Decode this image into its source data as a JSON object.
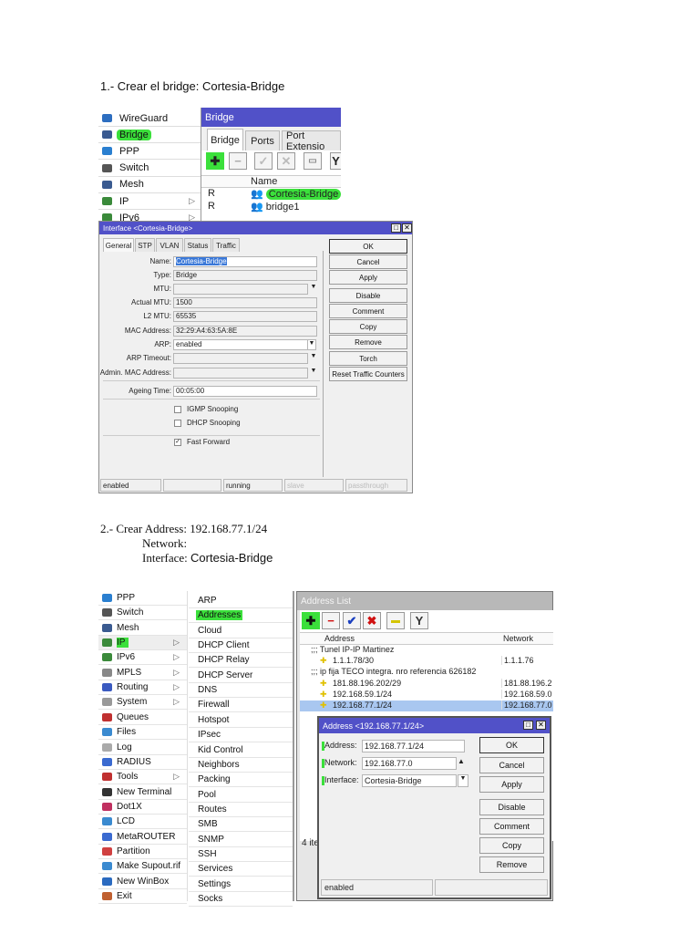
{
  "step1": {
    "heading": "1.- Crear el bridge: Cortesia-Bridge"
  },
  "shot1": {
    "sidebar": [
      "WireGuard",
      "Bridge",
      "PPP",
      "Switch",
      "Mesh",
      "IP",
      "IPv6"
    ],
    "bridge_window": {
      "title": "Bridge",
      "tabs": [
        "Bridge",
        "Ports",
        "Port Extensio"
      ],
      "col_name": "Name",
      "rows": [
        {
          "flag": "R",
          "name": "Cortesia-Bridge"
        },
        {
          "flag": "R",
          "name": "bridge1"
        }
      ]
    },
    "dialog": {
      "title": "Interface <Cortesia-Bridge>",
      "tabs": [
        "General",
        "STP",
        "VLAN",
        "Status",
        "Traffic"
      ],
      "fields": [
        {
          "label": "Name:",
          "value": "Cortesia-Bridge"
        },
        {
          "label": "Type:",
          "value": "Bridge"
        },
        {
          "label": "MTU:",
          "value": ""
        },
        {
          "label": "Actual MTU:",
          "value": "1500"
        },
        {
          "label": "L2 MTU:",
          "value": "65535"
        },
        {
          "label": "MAC Address:",
          "value": "32:29:A4:63:5A:8E"
        },
        {
          "label": "ARP:",
          "value": "enabled"
        },
        {
          "label": "ARP Timeout:",
          "value": ""
        },
        {
          "label": "Admin. MAC Address:",
          "value": ""
        },
        {
          "label": "Ageing Time:",
          "value": "00:05:00"
        }
      ],
      "checkboxes": [
        {
          "label": "IGMP Snooping",
          "checked": false
        },
        {
          "label": "DHCP Snooping",
          "checked": false
        },
        {
          "label": "Fast Forward",
          "checked": true
        }
      ],
      "buttons": [
        "OK",
        "Cancel",
        "Apply",
        "Disable",
        "Comment",
        "Copy",
        "Remove",
        "Torch",
        "Reset Traffic Counters"
      ],
      "status": [
        "enabled",
        "",
        "running",
        "slave",
        "passthrough"
      ]
    }
  },
  "step2": {
    "heading_prefix": "2.- Crear Address: ",
    "heading_value": "192.168.77.1/24",
    "network_label": "Network:",
    "interface_label": "Interface: ",
    "interface_value": "Cortesia-Bridge"
  },
  "shot2": {
    "menu": [
      "PPP",
      "Switch",
      "Mesh",
      "IP",
      "IPv6",
      "MPLS",
      "Routing",
      "System",
      "Queues",
      "Files",
      "Log",
      "RADIUS",
      "Tools",
      "New Terminal",
      "Dot1X",
      "LCD",
      "MetaROUTER",
      "Partition",
      "Make Supout.rif",
      "New WinBox",
      "Exit"
    ],
    "submenu": [
      "ARP",
      "Addresses",
      "Cloud",
      "DHCP Client",
      "DHCP Relay",
      "DHCP Server",
      "DNS",
      "Firewall",
      "Hotspot",
      "IPsec",
      "Kid Control",
      "Neighbors",
      "Packing",
      "Pool",
      "Routes",
      "SMB",
      "SNMP",
      "SSH",
      "Services",
      "Settings",
      "Socks"
    ],
    "address_list": {
      "title": "Address List",
      "col_address": "Address",
      "col_network": "Network",
      "rows": [
        {
          "type": "comment",
          "address": ";;; Tunel IP-IP Martinez",
          "network": ""
        },
        {
          "type": "item",
          "address": "1.1.1.78/30",
          "network": "1.1.1.76"
        },
        {
          "type": "comment",
          "address": ";;; ip fija TECO integra. nro referencia 626182",
          "network": ""
        },
        {
          "type": "item",
          "address": "181.88.196.202/29",
          "network": "181.88.196.2"
        },
        {
          "type": "item",
          "address": "192.168.59.1/24",
          "network": "192.168.59.0"
        },
        {
          "type": "item",
          "address": "192.168.77.1/24",
          "network": "192.168.77.0",
          "selected": true
        }
      ],
      "count": "4 ite"
    },
    "address_dialog": {
      "title": "Address <192.168.77.1/24>",
      "fields": [
        {
          "label": "Address:",
          "value": "192.168.77.1/24"
        },
        {
          "label": "Network:",
          "value": "192.168.77.0"
        },
        {
          "label": "Interface:",
          "value": "Cortesia-Bridge"
        }
      ],
      "buttons": [
        "OK",
        "Cancel",
        "Apply",
        "Disable",
        "Comment",
        "Copy",
        "Remove"
      ],
      "status": "enabled"
    }
  },
  "colors": {
    "title_blue": "#5151c8",
    "highlight": "#3be03b",
    "selected_row": "#a9c7f0"
  }
}
